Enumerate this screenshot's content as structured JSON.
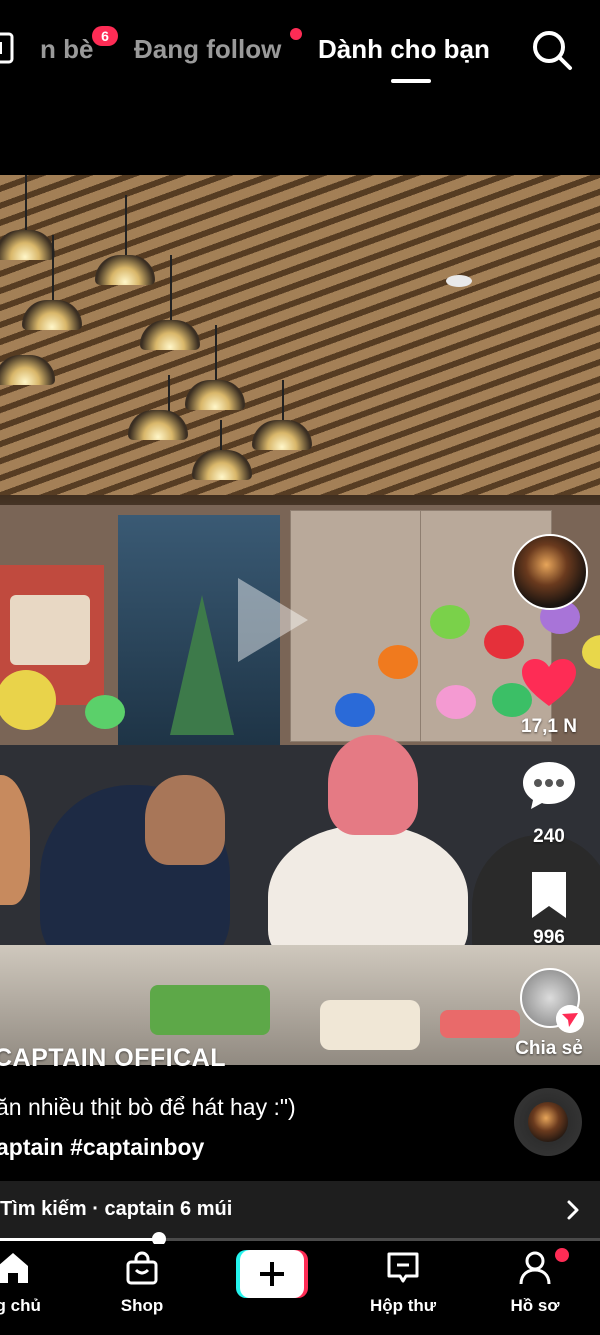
{
  "top_tabs": {
    "friends_label": "n bè",
    "friends_badge": "6",
    "following_label": "Đang follow",
    "for_you_label": "Dành cho bạn"
  },
  "video": {
    "author": "CAPTAIN OFFICAL",
    "caption": "ăn nhiều thịt bò để hát hay :\")",
    "hashtags": "aptain #captainboy"
  },
  "rail": {
    "likes": "17,1 N",
    "comments": "240",
    "saves": "996",
    "share_label": "Chia sẻ"
  },
  "search_suggestion": {
    "text": "Tìm kiếm · captain 6 múi"
  },
  "playback": {
    "progress": 0.265
  },
  "bottom_nav": {
    "home": "ng chủ",
    "shop": "Shop",
    "inbox": "Hộp thư",
    "profile": "Hồ sơ"
  },
  "colors": {
    "accent_red": "#fe2c55",
    "accent_cyan": "#25f4ee"
  }
}
